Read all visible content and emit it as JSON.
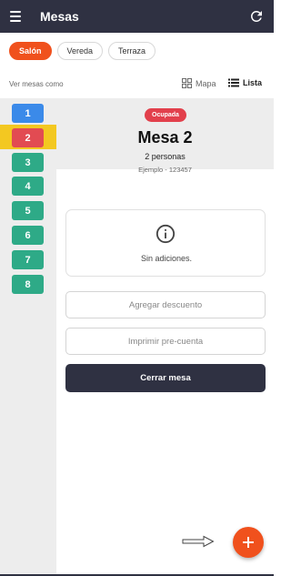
{
  "header": {
    "title": "Mesas",
    "menu_icon": "menu-icon",
    "refresh_icon": "refresh-icon"
  },
  "filters": {
    "items": [
      "Salón",
      "Vereda",
      "Terraza"
    ],
    "active": "Salón"
  },
  "view": {
    "label": "Ver mesas como",
    "mapa": "Mapa",
    "lista": "Lista",
    "selected": "Lista"
  },
  "tables": {
    "items": [
      {
        "number": "1",
        "color": "#3b8ae9"
      },
      {
        "number": "2",
        "color": "#e24b52"
      },
      {
        "number": "3",
        "color": "#2eaa87"
      },
      {
        "number": "4",
        "color": "#2eaa87"
      },
      {
        "number": "5",
        "color": "#2eaa87"
      },
      {
        "number": "6",
        "color": "#2eaa87"
      },
      {
        "number": "7",
        "color": "#2eaa87"
      },
      {
        "number": "8",
        "color": "#2eaa87"
      }
    ],
    "selected": "2",
    "selected_highlight": "#f3c821"
  },
  "detail": {
    "status": "Ocupada",
    "title": "Mesa 2",
    "guests": "2 personas",
    "client": "Ejemplo - 123457",
    "additions_empty": "Sin adiciones.",
    "discount_button": "Agregar descuento",
    "precheck_button": "Imprimir pre-cuenta",
    "close_button": "Cerrar mesa"
  },
  "colors": {
    "primary": "#2f3142",
    "accent": "#f0511d",
    "occupied": "#e2404c"
  }
}
